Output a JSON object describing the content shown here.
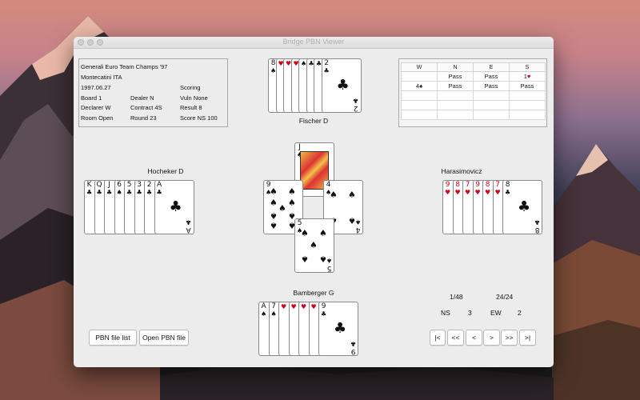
{
  "window": {
    "title": "Bridge PBN Viewer"
  },
  "info": {
    "event": "Generali Euro Team Champs '97",
    "site": "Montecatini ITA",
    "date": "1997.06.27",
    "board": "Board 1",
    "declarer": "Declarer W",
    "room": "Room Open",
    "dealer": "Dealer N",
    "contract": "Contract 4S",
    "round": "Round 23",
    "scoring": "Scoring",
    "vuln": "Vuln None",
    "result": "Result 8",
    "score": "Score NS 100"
  },
  "bidding": {
    "headers": [
      "W",
      "N",
      "E",
      "S"
    ],
    "rows": [
      [
        "",
        "Pass",
        "Pass",
        "1♥"
      ],
      [
        "4♠",
        "Pass",
        "Pass",
        "Pass"
      ]
    ],
    "suit_colors": {
      "hearts": "#d0021b",
      "spades": "#111111"
    }
  },
  "players": {
    "north": "Fischer D",
    "west": "Hocheker D",
    "east": "Harasimovicz",
    "south": "Bamberger G"
  },
  "hands": {
    "north": [
      {
        "rank": "8",
        "suit": "♠",
        "color": "black"
      },
      {
        "rank": "",
        "suit": "♥",
        "color": "red"
      },
      {
        "rank": "",
        "suit": "♥",
        "color": "red"
      },
      {
        "rank": "",
        "suit": "♥",
        "color": "red"
      },
      {
        "rank": "",
        "suit": "♠",
        "color": "black"
      },
      {
        "rank": "",
        "suit": "♣",
        "color": "black"
      },
      {
        "rank": "",
        "suit": "♣",
        "color": "black"
      },
      {
        "rank": "2",
        "suit": "♣",
        "color": "black"
      }
    ],
    "west": [
      {
        "rank": "K",
        "suit": "♣",
        "color": "black"
      },
      {
        "rank": "Q",
        "suit": "♣",
        "color": "black"
      },
      {
        "rank": "J",
        "suit": "♣",
        "color": "black"
      },
      {
        "rank": "6",
        "suit": "♠",
        "color": "black"
      },
      {
        "rank": "5",
        "suit": "♣",
        "color": "black"
      },
      {
        "rank": "3",
        "suit": "♣",
        "color": "black"
      },
      {
        "rank": "2",
        "suit": "♣",
        "color": "black"
      },
      {
        "rank": "A",
        "suit": "♣",
        "color": "black"
      }
    ],
    "east": [
      {
        "rank": "9",
        "suit": "♥",
        "color": "red"
      },
      {
        "rank": "8",
        "suit": "♥",
        "color": "red"
      },
      {
        "rank": "7",
        "suit": "♥",
        "color": "red"
      },
      {
        "rank": "9",
        "suit": "♥",
        "color": "red"
      },
      {
        "rank": "8",
        "suit": "♥",
        "color": "red"
      },
      {
        "rank": "7",
        "suit": "♥",
        "color": "red"
      },
      {
        "rank": "8",
        "suit": "♣",
        "color": "black"
      }
    ],
    "south": [
      {
        "rank": "A",
        "suit": "♠",
        "color": "black"
      },
      {
        "rank": "7",
        "suit": "♠",
        "color": "black"
      },
      {
        "rank": "",
        "suit": "♥",
        "color": "red"
      },
      {
        "rank": "",
        "suit": "♥",
        "color": "red"
      },
      {
        "rank": "",
        "suit": "♥",
        "color": "red"
      },
      {
        "rank": "",
        "suit": "♥",
        "color": "red"
      },
      {
        "rank": "9",
        "suit": "♣",
        "color": "black"
      }
    ]
  },
  "trick": {
    "north": {
      "rank": "J",
      "suit": "♠",
      "color": "black"
    },
    "west": {
      "rank": "9",
      "suit": "♠",
      "color": "black"
    },
    "east": {
      "rank": "4",
      "suit": "♠",
      "color": "black"
    },
    "south": {
      "rank": "5",
      "suit": "♠",
      "color": "black"
    }
  },
  "status": {
    "game_position": "1/48",
    "trick_position": "24/24",
    "ns_label": "NS",
    "ns_tricks": "3",
    "ew_label": "EW",
    "ew_tricks": "2"
  },
  "buttons": {
    "pbn_list": "PBN file list",
    "open_pbn": "Open PBN file",
    "first": "|<",
    "prev_fast": "<<",
    "prev": "<",
    "next": ">",
    "next_fast": ">>",
    "last": ">|"
  }
}
